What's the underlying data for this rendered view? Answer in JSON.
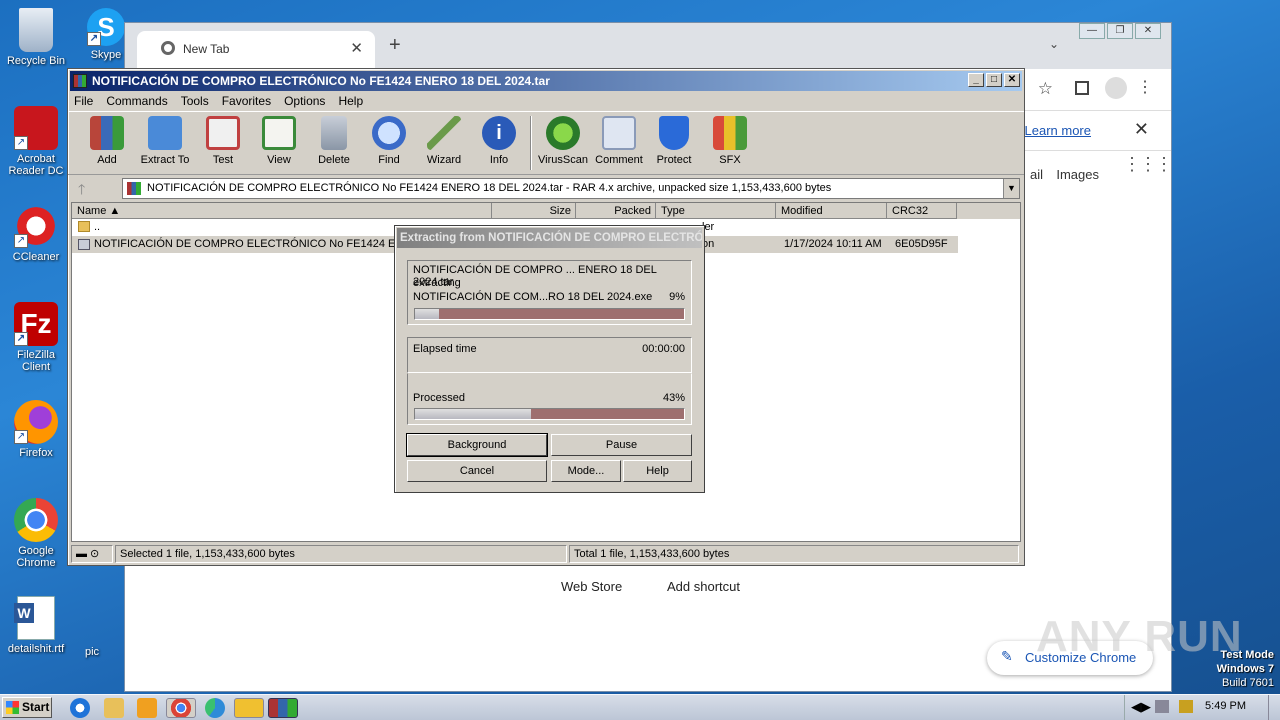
{
  "desktop": {
    "icons": [
      {
        "label": "Recycle Bin",
        "icon": "recycle-bin-icon"
      },
      {
        "label": "Acrobat Reader DC",
        "icon": "acrobat-icon"
      },
      {
        "label": "CCleaner",
        "icon": "ccleaner-icon"
      },
      {
        "label": "FileZilla Client",
        "icon": "filezilla-icon"
      },
      {
        "label": "Firefox",
        "icon": "firefox-icon"
      },
      {
        "label": "Google Chrome",
        "icon": "chrome-icon"
      },
      {
        "label": "detailshit.rtf",
        "icon": "word-doc-icon"
      }
    ],
    "partial_labels": {
      "skype": "Skype",
      "pic": "pic"
    }
  },
  "chrome": {
    "tab_title": "New Tab",
    "learn_more": "Learn more",
    "gmail": "ail",
    "images": "Images",
    "web_store": "Web Store",
    "add_shortcut": "Add shortcut",
    "customize": "Customize Chrome"
  },
  "winrar": {
    "title": "NOTIFICACIÓN DE COMPRO ELECTRÓNICO No FE1424 ENERO 18 DEL 2024.tar",
    "menu": [
      "File",
      "Commands",
      "Tools",
      "Favorites",
      "Options",
      "Help"
    ],
    "toolbar": [
      {
        "label": "Add",
        "icon": "add-archive-icon",
        "color": "#b8453a"
      },
      {
        "label": "Extract To",
        "icon": "extract-folder-icon",
        "color": "#4a8ad8"
      },
      {
        "label": "Test",
        "icon": "test-clipboard-icon",
        "color": "#c04040"
      },
      {
        "label": "View",
        "icon": "view-book-icon",
        "color": "#3a8a3a"
      },
      {
        "label": "Delete",
        "icon": "delete-trash-icon",
        "color": "#8a96a6"
      },
      {
        "label": "Find",
        "icon": "find-magnifier-icon",
        "color": "#3a6ac8"
      },
      {
        "label": "Wizard",
        "icon": "wizard-wand-icon",
        "color": "#6a9a4a"
      },
      {
        "label": "Info",
        "icon": "info-icon",
        "color": "#2a5ab8"
      },
      {
        "label": "VirusScan",
        "icon": "virus-scan-icon",
        "color": "#2a9a2a"
      },
      {
        "label": "Comment",
        "icon": "comment-icon",
        "color": "#8a9ab8"
      },
      {
        "label": "Protect",
        "icon": "protect-shield-icon",
        "color": "#2a6ad8"
      },
      {
        "label": "SFX",
        "icon": "sfx-box-icon",
        "color": "#d87a2a"
      }
    ],
    "address": "NOTIFICACIÓN DE COMPRO ELECTRÓNICO No FE1424 ENERO 18 DEL 2024.tar - RAR 4.x archive, unpacked size 1,153,433,600 bytes",
    "columns": [
      "Name",
      "Size",
      "Packed",
      "Type",
      "Modified",
      "CRC32"
    ],
    "rows": [
      {
        "name": "..",
        "type": "ler",
        "modified": "",
        "crc": ""
      },
      {
        "name": "NOTIFICACIÓN DE COMPRO ELECTRÓNICO No FE1424 ENERO",
        "type": "on",
        "modified": "1/17/2024 10:11 AM",
        "crc": "6E05D95F"
      }
    ],
    "status_left": "Selected 1 file, 1,153,433,600 bytes",
    "status_right": "Total 1 file, 1,153,433,600 bytes"
  },
  "extract_dialog": {
    "title": "Extracting from NOTIFICACIÓN DE COMPRO ELECTRÓ...",
    "archive": "NOTIFICACIÓN DE COMPRO ... ENERO 18 DEL 2024.tar",
    "action": "extracting",
    "file": "NOTIFICACIÓN DE COM...RO 18 DEL 2024.exe",
    "file_percent": "9%",
    "file_progress": 0.09,
    "elapsed_label": "Elapsed time",
    "elapsed_value": "00:00:00",
    "processed_label": "Processed",
    "processed_percent": "43%",
    "processed_progress": 0.43,
    "buttons": {
      "background": "Background",
      "pause": "Pause",
      "cancel": "Cancel",
      "mode": "Mode...",
      "help": "Help"
    }
  },
  "taskbar": {
    "start": "Start",
    "clock": "5:49 PM"
  },
  "watermark": {
    "brand": "ANY RUN",
    "line1": "Test Mode",
    "line2": "Windows 7",
    "line3": "Build 7601"
  }
}
